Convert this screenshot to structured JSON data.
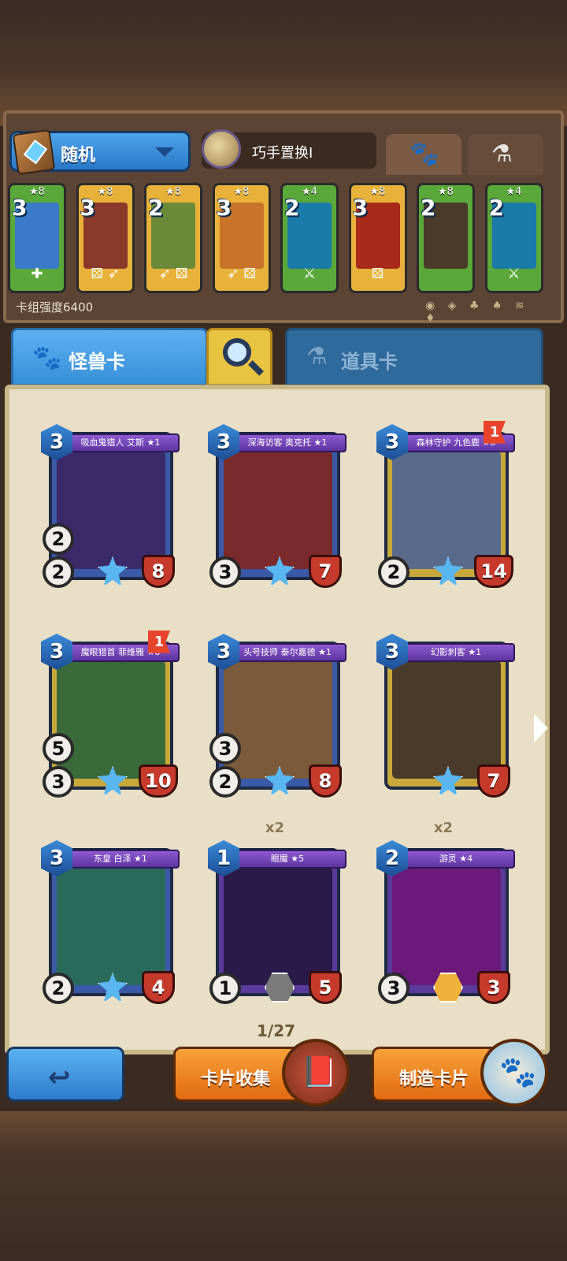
{
  "deck": {
    "selector_label": "随机",
    "skill_name": "巧手置换I",
    "power_label": "卡组强度6400",
    "traits_icons": "◉ ◈ ♣ ♠ ≋ ♦"
  },
  "deck_tabs": [
    {
      "name": "monster-tab-icon",
      "icon": "🐾"
    },
    {
      "name": "item-tab-icon",
      "icon": "⚗"
    }
  ],
  "mini_cards": [
    {
      "cost": "3",
      "stars": "★8",
      "color": "#5aa83a",
      "art": "#3a7ac8",
      "icons": "✚"
    },
    {
      "cost": "3",
      "stars": "★8",
      "color": "#e8b23a",
      "art": "#8a3a2a",
      "icons": "⚄ ➶"
    },
    {
      "cost": "2",
      "stars": "★8",
      "color": "#e8b23a",
      "art": "#6a8a3a",
      "icons": "➶ ⚄"
    },
    {
      "cost": "3",
      "stars": "★8",
      "color": "#e8b23a",
      "art": "#c8722a",
      "icons": "➶ ⚄"
    },
    {
      "cost": "2",
      "stars": "★4",
      "color": "#5aa83a",
      "art": "#1a7aa8",
      "icons": "⚔"
    },
    {
      "cost": "3",
      "stars": "★8",
      "color": "#e8b23a",
      "art": "#a82a1a",
      "icons": "⚄"
    },
    {
      "cost": "2",
      "stars": "★8",
      "color": "#5aa83a",
      "art": "#4a3a2a",
      "icons": ""
    },
    {
      "cost": "2",
      "stars": "★4",
      "color": "#5aa83a",
      "art": "#1a7aa8",
      "icons": "⚔"
    }
  ],
  "category": {
    "monster_label": "怪兽卡",
    "item_label": "道具卡"
  },
  "cards": [
    {
      "name": "吸血鬼猎人 艾斯 ★1",
      "cost": "3",
      "atk": "2",
      "atk2": "2",
      "hp": "8",
      "frame": "#3a5aa8",
      "art": "#3a2a6a",
      "gem": "blue",
      "flag": "",
      "dup": ""
    },
    {
      "name": "深海访客 奥克托 ★1",
      "cost": "3",
      "atk": "",
      "atk2": "3",
      "hp": "7",
      "frame": "#3a5aa8",
      "art": "#7a2a2a",
      "gem": "blue",
      "flag": "",
      "dup": ""
    },
    {
      "name": "森林守护 九色鹿 ★8",
      "cost": "3",
      "atk": "",
      "atk2": "2",
      "hp": "14",
      "frame": "#c8a83a",
      "art": "#5a6a8a",
      "gem": "blue",
      "flag": "1",
      "dup": ""
    },
    {
      "name": "魔眼猎首 菲维雅 ★8",
      "cost": "3",
      "atk": "5",
      "atk2": "3",
      "hp": "10",
      "frame": "#c8a83a",
      "art": "#3a6a3a",
      "gem": "blue",
      "flag": "1",
      "dup": ""
    },
    {
      "name": "头号技师 泰尔嘉德 ★1",
      "cost": "3",
      "atk": "3",
      "atk2": "2",
      "hp": "8",
      "frame": "#3a5aa8",
      "art": "#7a5a3a",
      "gem": "blue",
      "flag": "",
      "dup": ""
    },
    {
      "name": "幻影刺客 ★1",
      "cost": "3",
      "atk": "",
      "atk2": "",
      "hp": "7",
      "frame": "#c8a83a",
      "art": "#4a3a2a",
      "gem": "blue",
      "flag": "",
      "dup": ""
    },
    {
      "name": "东皇 白泽 ★1",
      "cost": "3",
      "atk": "",
      "atk2": "2",
      "hp": "4",
      "frame": "#3a5aa8",
      "art": "#2a6a5a",
      "gem": "blue",
      "flag": "",
      "dup": ""
    },
    {
      "name": "眼魔 ★5",
      "cost": "1",
      "atk": "",
      "atk2": "1",
      "hp": "5",
      "frame": "#5a3a9a",
      "art": "#2a1a4a",
      "gem": "gray",
      "flag": "",
      "dup": "x2"
    },
    {
      "name": "游灵 ★4",
      "cost": "2",
      "atk": "",
      "atk2": "3",
      "hp": "3",
      "frame": "#5a3a9a",
      "art": "#6a1a7a",
      "gem": "gold",
      "flag": "",
      "dup": "x2"
    }
  ],
  "pager": "1/27",
  "buttons": {
    "back_icon": "↩",
    "collect_label": "卡片收集",
    "craft_label": "制造卡片",
    "collect_icon": "📕",
    "craft_icon": "🐾"
  }
}
